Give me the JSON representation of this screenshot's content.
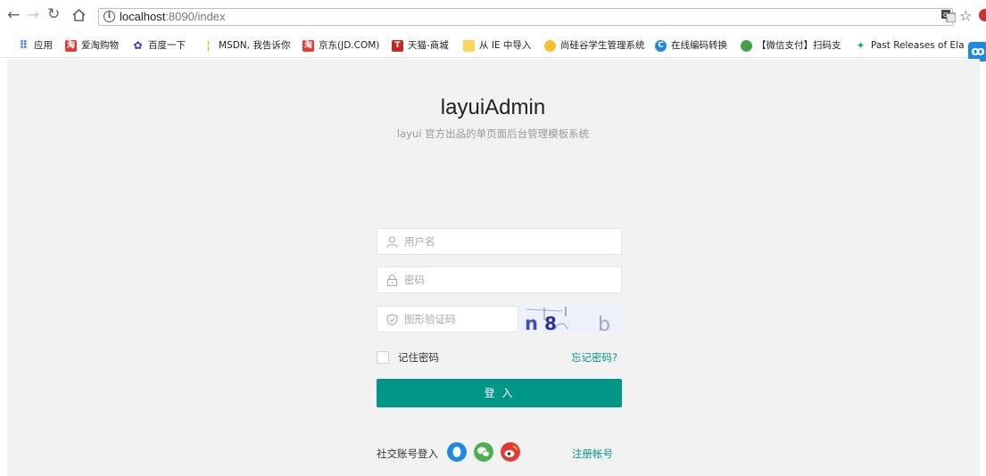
{
  "browser": {
    "url_host": "localhost",
    "url_rest": ":8090/index",
    "back_icon": "arrow-left",
    "forward_icon": "arrow-right",
    "reload_icon": "reload",
    "home_icon": "home",
    "info_glyph": "i",
    "star_icon": "star"
  },
  "bookmarks": [
    {
      "label": "应用",
      "icon": "apps-grid",
      "color": "#4285f4",
      "glyph": ""
    },
    {
      "label": "爱淘购物",
      "icon": "taobao",
      "color": "#e53935",
      "glyph": "淘"
    },
    {
      "label": "百度一下",
      "icon": "baidu-paw",
      "color": "#2932e1",
      "glyph": "✿"
    },
    {
      "label": "MSDN, 我告诉你",
      "icon": "msdn",
      "color": "#f4b400",
      "glyph": "¦"
    },
    {
      "label": "京东(JD.COM)",
      "icon": "jd",
      "color": "#e53935",
      "glyph": "淘"
    },
    {
      "label": "天猫-商城",
      "icon": "tmall",
      "color": "#c62828",
      "glyph": "T"
    },
    {
      "label": "从 IE 中导入",
      "icon": "folder",
      "color": "#f9d55a",
      "glyph": ""
    },
    {
      "label": "尚硅谷学生管理系统",
      "icon": "globe",
      "color": "#fbc02d",
      "glyph": ""
    },
    {
      "label": "在线编码转换",
      "icon": "c-circle",
      "color": "#1e88e5",
      "glyph": "C"
    },
    {
      "label": "【微信支付】扫码支",
      "icon": "wechat",
      "color": "#43a047",
      "glyph": ""
    },
    {
      "label": "Past Releases of Ela",
      "icon": "elastic",
      "color": "#26a69a",
      "glyph": "✦"
    }
  ],
  "side_badge": "ꝏ",
  "login": {
    "title": "layuiAdmin",
    "subtitle": "layui 官方出品的单页面后台管理模板系统",
    "username_placeholder": "用户名",
    "password_placeholder": "密码",
    "captcha_placeholder": "图形验证码",
    "captcha_text": "n8b",
    "remember_label": "记住密码",
    "forgot_link": "忘记密码?",
    "login_button": "登 入",
    "social_label": "社交账号登入",
    "register_link": "注册帐号",
    "social_icons": [
      "qq-icon",
      "wechat-icon",
      "weibo-icon"
    ],
    "accent_color": "#009688"
  }
}
